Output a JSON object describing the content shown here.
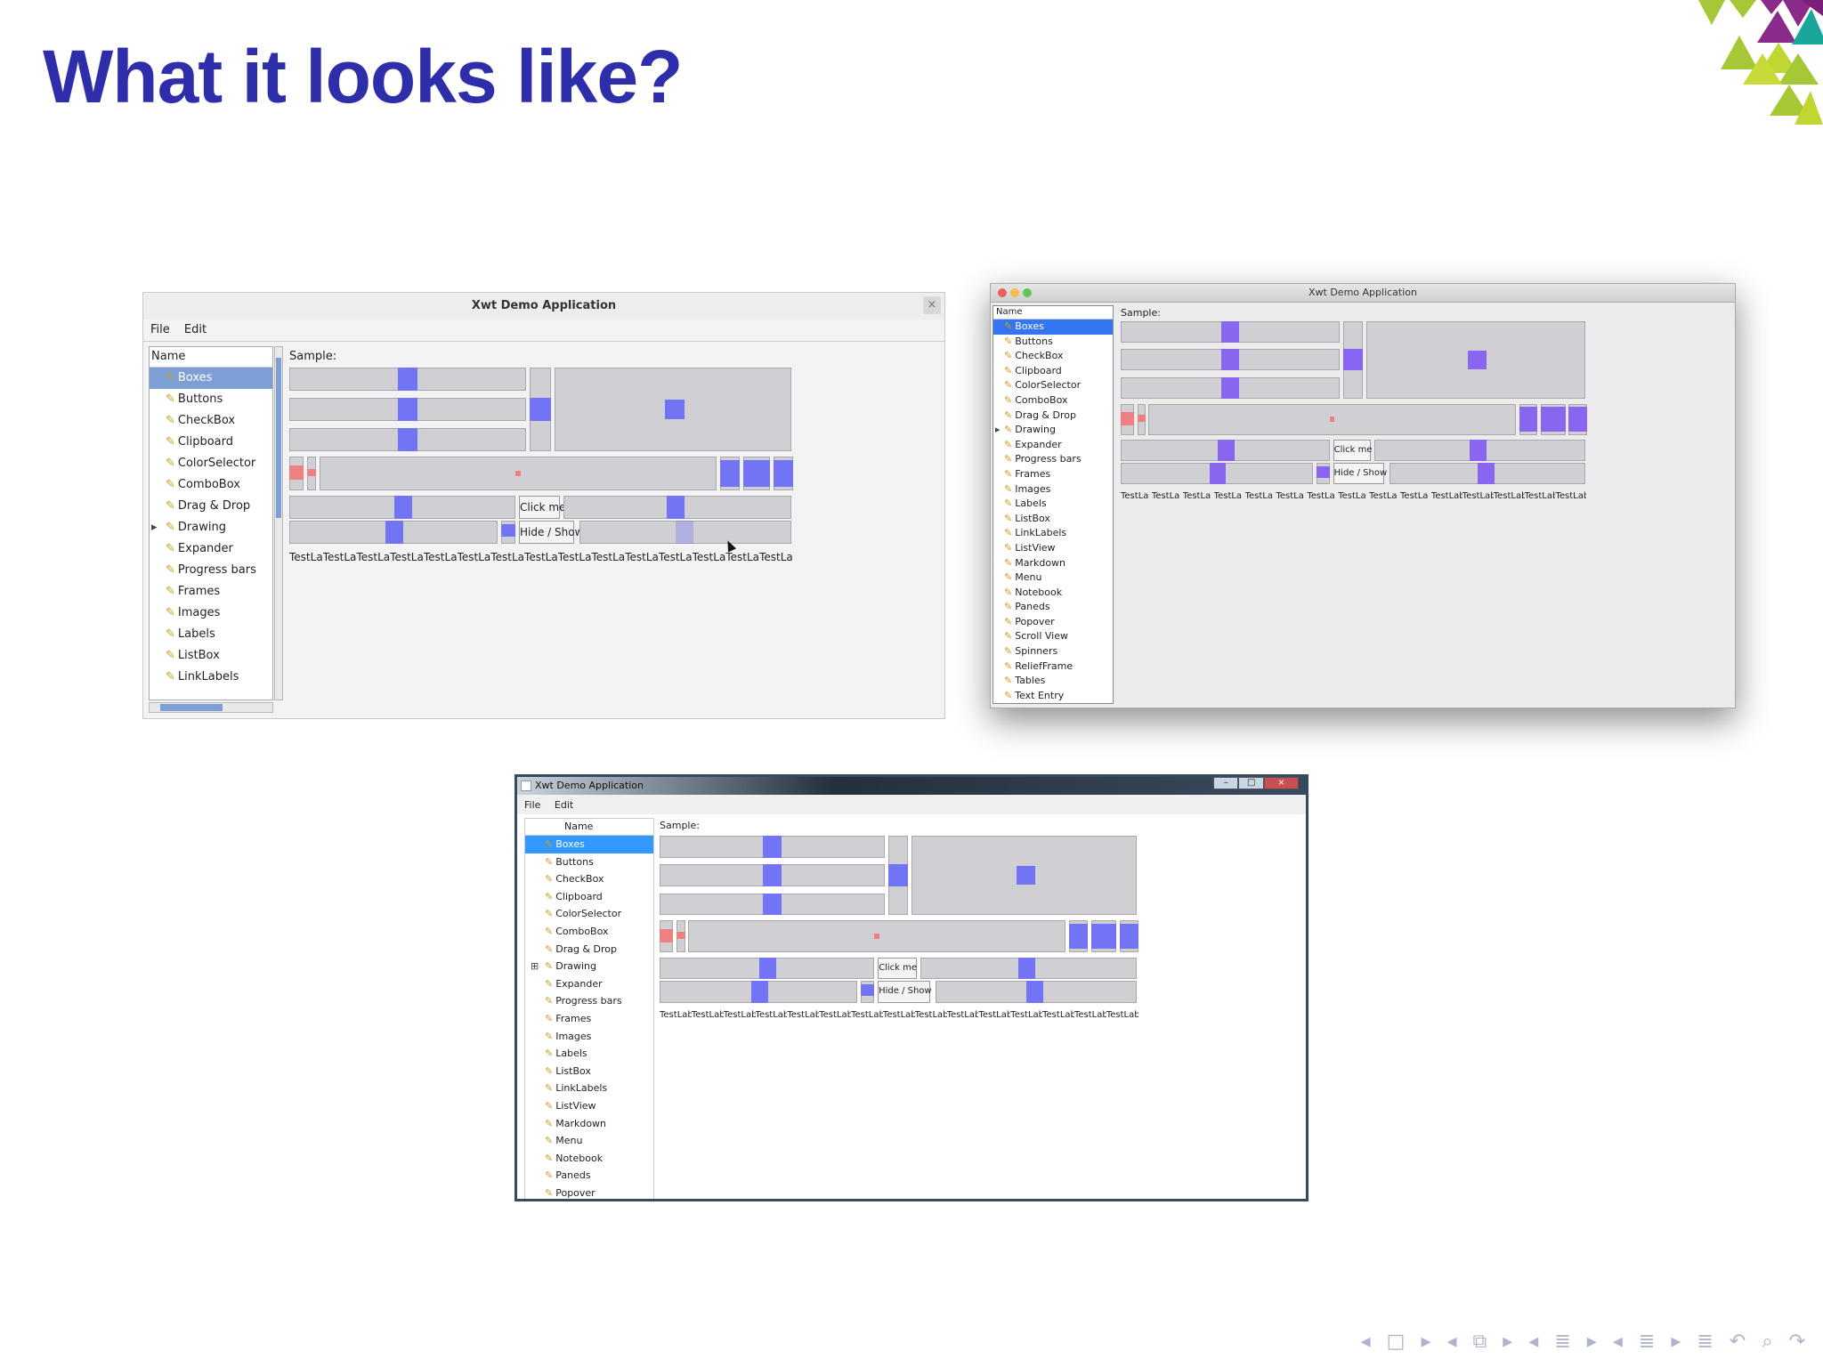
{
  "slide": {
    "title": "What it looks like?"
  },
  "windows": [
    {
      "title": "Xwt Demo Application",
      "menu": [
        "File",
        "Edit"
      ],
      "tree_header": "Name",
      "sample_label": "Sample:",
      "items": [
        "Boxes",
        "Buttons",
        "CheckBox",
        "Clipboard",
        "ColorSelector",
        "ComboBox",
        "Drag & Drop",
        "Drawing",
        "Expander",
        "Progress bars",
        "Frames",
        "Images",
        "Labels",
        "ListBox",
        "LinkLabels"
      ],
      "click_label": "Click me",
      "hide_label": "Hide / Show",
      "test_labels": [
        "TestLa",
        "TestLa",
        "TestLa",
        "TestLa",
        "TestLa",
        "TestLal",
        "TestLal",
        "TestLal",
        "TestLal",
        "TestLal",
        "TestLabı",
        "TestLabı",
        "TestLabı",
        "TestLabı",
        "TestLabı"
      ]
    },
    {
      "title": "Xwt Demo Application",
      "tree_header": "Name",
      "sample_label": "Sample:",
      "items": [
        "Boxes",
        "Buttons",
        "CheckBox",
        "Clipboard",
        "ColorSelector",
        "ComboBox",
        "Drag & Drop",
        "Drawing",
        "Expander",
        "Progress bars",
        "Frames",
        "Images",
        "Labels",
        "ListBox",
        "LinkLabels",
        "ListView",
        "Markdown",
        "Menu",
        "Notebook",
        "Paneds",
        "Popover",
        "Scroll View",
        "Spinners",
        "ReliefFrame",
        "Tables",
        "Text Entry"
      ],
      "click_label": "Click me",
      "hide_label": "Hide / Show",
      "test_labels": [
        "TestLa",
        "TestLa",
        "TestLa",
        "TestLa",
        "TestLa",
        "TestLa",
        "TestLa",
        "TestLa",
        "TestLa",
        "TestLa",
        "TestLab",
        "TestLab",
        "TestLab",
        "TestLab",
        "TestLab"
      ]
    },
    {
      "title": "Xwt Demo Application",
      "menu": [
        "File",
        "Edit"
      ],
      "tree_header": "Name",
      "sample_label": "Sample:",
      "items": [
        "Boxes",
        "Buttons",
        "CheckBox",
        "Clipboard",
        "ColorSelector",
        "ComboBox",
        "Drag & Drop",
        "Drawing",
        "Expander",
        "Progress bars",
        "Frames",
        "Images",
        "Labels",
        "ListBox",
        "LinkLabels",
        "ListView",
        "Markdown",
        "Menu",
        "Notebook",
        "Paneds",
        "Popover"
      ],
      "click_label": "Click me",
      "hide_label": "Hide / Show",
      "test_labels": [
        "TestLabı",
        "TestLabı",
        "TestLabı",
        "TestLabı",
        "TestLabı",
        "TestLabı",
        "TestLabe",
        "TestLabe",
        "TestLabe",
        "TestLabe",
        "TestLabel:",
        "TestLabel:",
        "TestLabel:",
        "TestLabel:",
        "TestLabel:"
      ]
    }
  ],
  "colors": {
    "title": "#2e2eaa",
    "widget_blue": "#7373f5",
    "widget_purple": "#8a66f0",
    "widget_red": "#f08080",
    "selection_linux": "#7d9fd6",
    "selection_mac": "#3476f1",
    "selection_win": "#3399ff"
  },
  "icons": [
    "tree-item-icon",
    "close-icon",
    "traffic-light-icon",
    "window-controls-icon",
    "expand-arrow-icon",
    "slide-nav-icons"
  ]
}
